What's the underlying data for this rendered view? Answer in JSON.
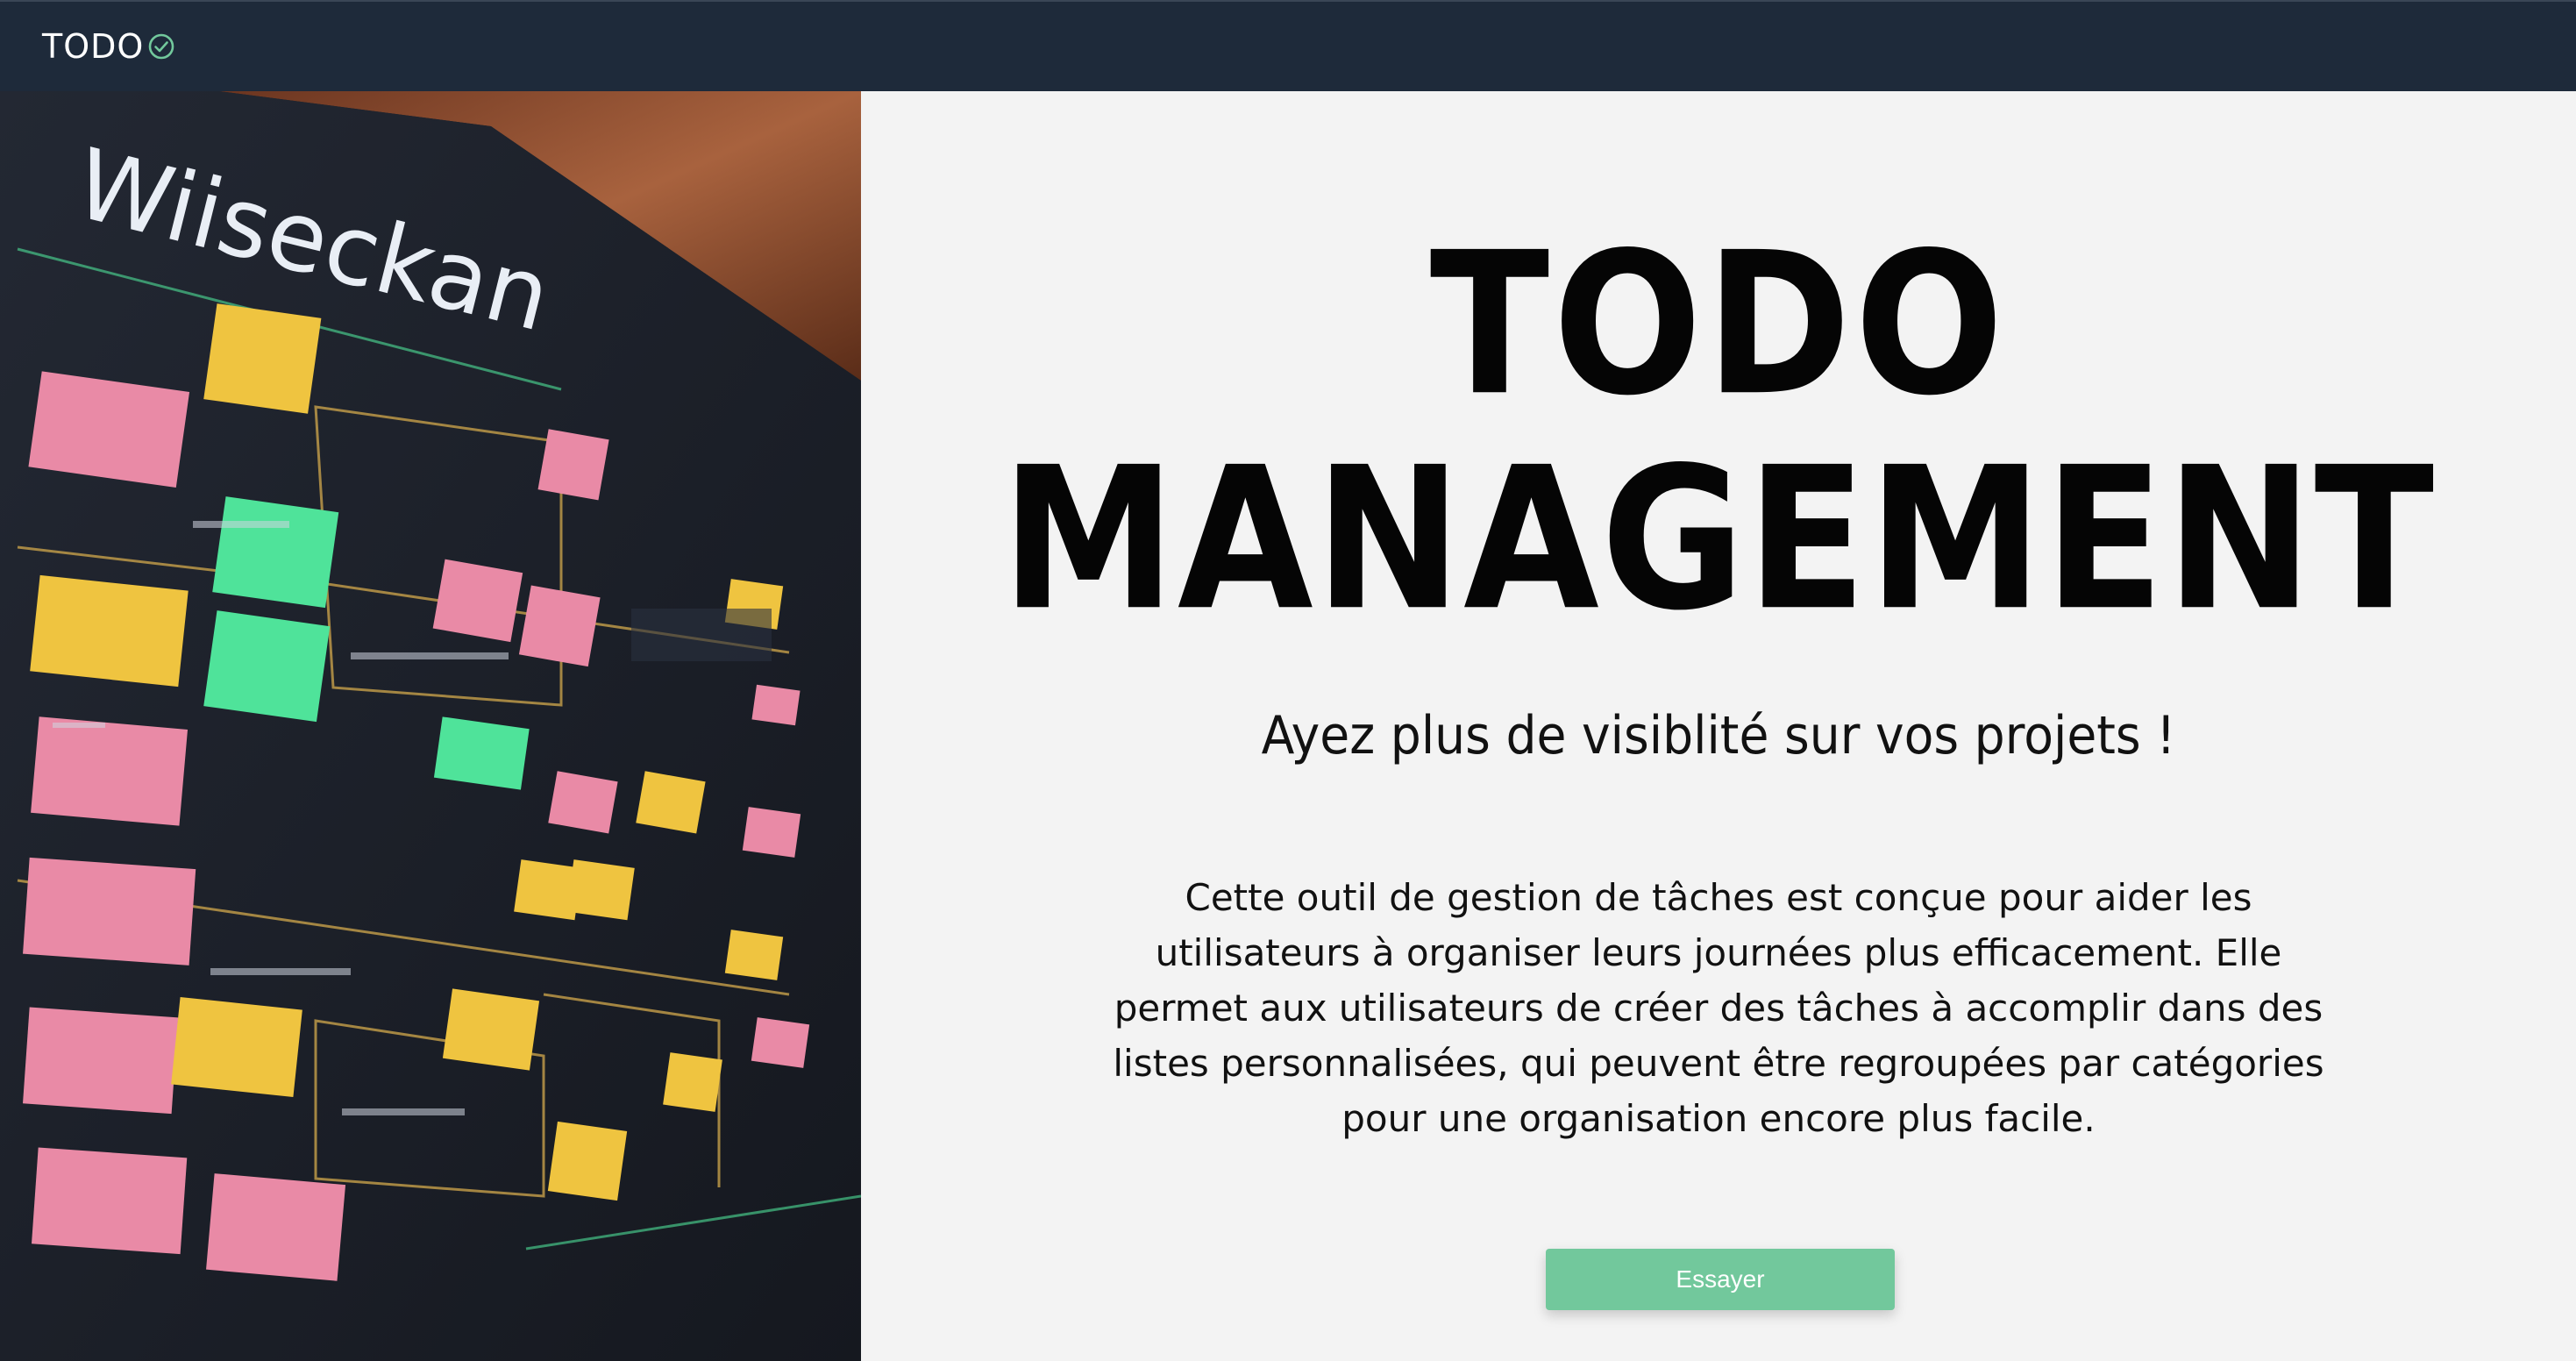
{
  "navbar": {
    "brand_text": "TODO",
    "brand_icon": "check-circle-icon"
  },
  "hero": {
    "board_heading": "Wiiseckan",
    "colors": {
      "board": "#1c1f26",
      "pink": "#e98aa6",
      "yellow": "#efc440",
      "green": "#4fe39a",
      "wood": "#8a4b2c"
    }
  },
  "main": {
    "title_line1": "TODO",
    "title_line2": "MANAGEMENT",
    "subtitle": "Ayez plus de visiblité sur vos projets !",
    "description": "Cette outil de gestion de tâches est conçue pour aider les utilisateurs à organiser leurs journées plus efficacement. Elle permet aux utilisateurs de créer des tâches à accomplir dans des listes personnalisées, qui peuvent être regroupées par catégories pour une organisation encore plus facile.",
    "cta_label": "Essayer"
  },
  "colors": {
    "navbar_bg": "#1e2a3a",
    "accent": "#72c89c",
    "page_bg": "#f3f3f3"
  }
}
